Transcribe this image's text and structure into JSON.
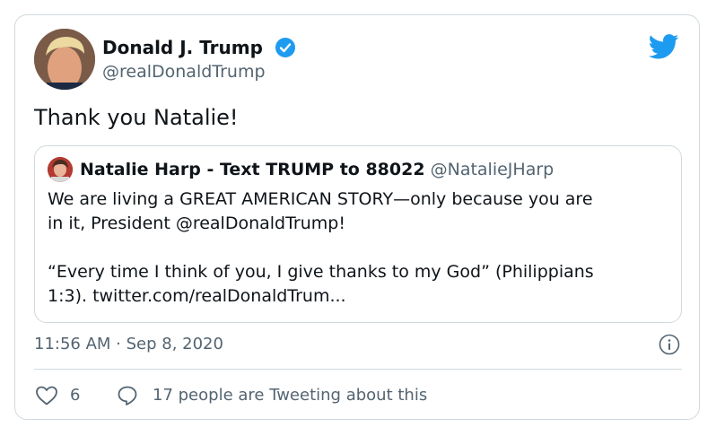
{
  "tweet": {
    "display_name": "Donald J. Trump",
    "handle": "@realDonaldTrump",
    "verified": true,
    "text": "Thank you Natalie!",
    "timestamp": "11:56 AM · Sep 8, 2020",
    "likes": "6",
    "conversation_text": "17 people are Tweeting about this"
  },
  "quoted_tweet": {
    "display_name": "Natalie Harp - Text TRUMP to 88022",
    "handle": "@NatalieJHarp",
    "line1": "We are living a GREAT AMERICAN STORY—only because you are",
    "line2": "in it, President @realDonaldTrump!",
    "line3": "“Every time I think of you, I give thanks to my God” (Philippians",
    "line4": "1:3). twitter.com/realDonaldTrum..."
  },
  "icons": {
    "brand": "twitter-bird-icon",
    "verified": "verified-badge-icon",
    "info": "info-icon",
    "like": "heart-icon",
    "reply": "reply-bubble-icon"
  },
  "colors": {
    "brand_blue": "#1d9bf0",
    "text": "#0f1419",
    "secondary_text": "#536471",
    "border": "#cfd9de"
  }
}
